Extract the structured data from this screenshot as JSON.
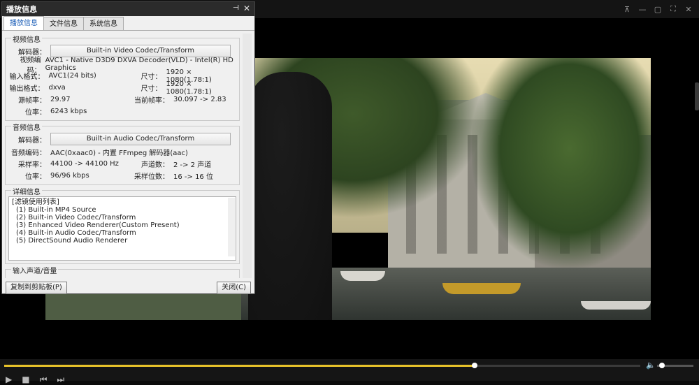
{
  "player": {
    "window_controls": [
      {
        "name": "pin-icon",
        "glyph": "⊼"
      },
      {
        "name": "minimize-icon",
        "glyph": "—"
      },
      {
        "name": "restore-icon",
        "glyph": "▢"
      },
      {
        "name": "fullscreen-icon",
        "glyph": "⛶"
      },
      {
        "name": "close-icon",
        "glyph": "✕"
      }
    ],
    "progress_fraction": 0.74,
    "volume_fraction": 0.05,
    "accent_color": "#e8c22a"
  },
  "dialog": {
    "title": "播放信息",
    "tabs": [
      "播放信息",
      "文件信息",
      "系统信息"
    ],
    "video": {
      "group_title": "视频信息",
      "decoder_label": "解码器：",
      "decoder_button": "Built-in Video Codec/Transform",
      "rows": [
        {
          "label": "视频编码：",
          "value": "AVC1 - Native D3D9 DXVA Decoder(VLD) - Intel(R) HD Graphics"
        },
        {
          "label": "输入格式：",
          "value": "AVC1(24 bits)",
          "label2": "尺寸：",
          "value2": "1920 × 1080(1.78:1)"
        },
        {
          "label": "输出格式：",
          "value": "dxva",
          "label2": "尺寸：",
          "value2": "1920 × 1080(1.78:1)"
        },
        {
          "label": "源帧率：",
          "value": "29.97",
          "label2": "当前帧率：",
          "value2": "30.097 -> 2.83"
        },
        {
          "label": "位率：",
          "value": "6243 kbps"
        }
      ]
    },
    "audio": {
      "group_title": "音频信息",
      "decoder_label": "解码器：",
      "decoder_button": "Built-in Audio Codec/Transform",
      "rows": [
        {
          "label": "音频编码：",
          "value": "AAC(0xaac0) - 内置 FFmpeg 解码器(aac)"
        },
        {
          "label": "采样率：",
          "value": "44100 -> 44100 Hz",
          "label2": "声道数：",
          "value2": "2 -> 2 声道"
        },
        {
          "label": "位率：",
          "value": "96/96 kbps",
          "label2": "采样位数：",
          "value2": "16 -> 16 位"
        }
      ]
    },
    "detail": {
      "group_title": "详细信息",
      "lines": [
        "[滤镜使用列表]",
        "(1) Built-in MP4 Source",
        "(2) Built-in Video Codec/Transform",
        "(3) Enhanced Video Renderer(Custom Present)",
        "(4) Built-in Audio Codec/Transform",
        "(5) DirectSound Audio Renderer"
      ]
    },
    "input_group_title": "输入声道/音量",
    "copy_button": "复制到剪贴板(P)",
    "close_button": "关闭(C)"
  }
}
